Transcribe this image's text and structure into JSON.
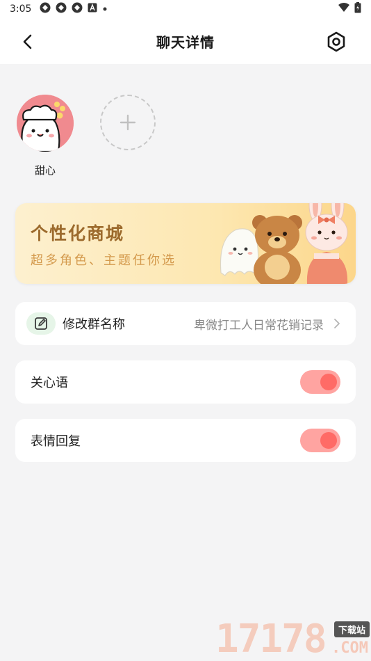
{
  "status_bar": {
    "time": "3:05",
    "icons": [
      "app-notification-icon",
      "app-notification-icon",
      "app-notification-icon",
      "a-icon",
      "dot-icon",
      "wifi-icon",
      "battery-icon"
    ]
  },
  "header": {
    "title": "聊天详情",
    "back_icon": "chevron-left-icon",
    "settings_icon": "hexagon-settings-icon"
  },
  "members": [
    {
      "name": "甜心"
    }
  ],
  "add_member_icon": "plus-icon",
  "banner": {
    "title": "个性化商城",
    "subtitle": "超多角色、主题任你选"
  },
  "settings": {
    "rename": {
      "label": "修改群名称",
      "value": "卑微打工人日常花销记录"
    },
    "care_words": {
      "label": "关心语",
      "enabled": true
    },
    "emoji_reply": {
      "label": "表情回复",
      "enabled": true
    }
  },
  "colors": {
    "toggle_track": "#ffa4a1",
    "toggle_knob": "#ff6b66",
    "avatar_bg": "#f08a8f",
    "banner_title": "#9c6a2c"
  },
  "watermark": {
    "digits": "17178",
    "badge": "下载站",
    "suffix": ".COM"
  }
}
